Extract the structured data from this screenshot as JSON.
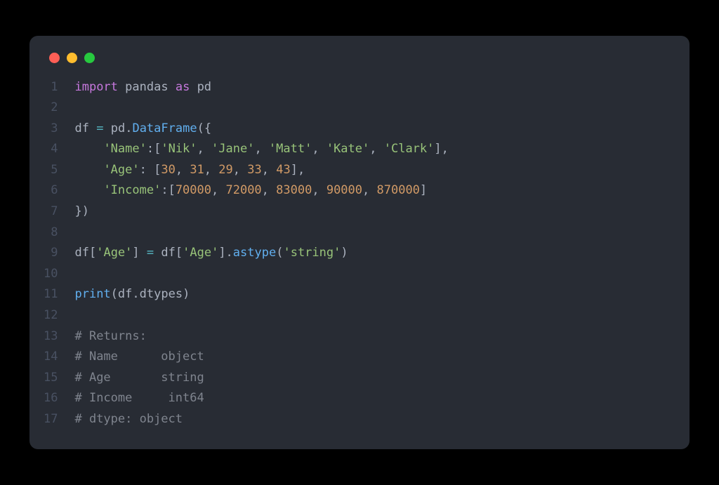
{
  "window": {
    "dots": [
      "close",
      "minimize",
      "zoom"
    ]
  },
  "code": {
    "line_count": 17,
    "tokens": {
      "l1_import": "import",
      "l1_pandas": "pandas",
      "l1_as": "as",
      "l1_pd": "pd",
      "l3_df": "df",
      "l3_eq": "=",
      "l3_pd": "pd",
      "l3_dot": ".",
      "l3_DataFrame": "DataFrame",
      "l3_open": "({",
      "l4_key": "'Name'",
      "l4_colon": ":",
      "l4_v1": "'Nik'",
      "l4_v2": "'Jane'",
      "l4_v3": "'Matt'",
      "l4_v4": "'Kate'",
      "l4_v5": "'Clark'",
      "l5_key": "'Age'",
      "l5_v1": "30",
      "l5_v2": "31",
      "l5_v3": "29",
      "l5_v4": "33",
      "l5_v5": "43",
      "l6_key": "'Income'",
      "l6_v1": "70000",
      "l6_v2": "72000",
      "l6_v3": "83000",
      "l6_v4": "90000",
      "l6_v5": "870000",
      "l7_close": "})",
      "l9_df": "df",
      "l9_idx": "'Age'",
      "l9_eq": "=",
      "l9_df2": "df",
      "l9_idx2": "'Age'",
      "l9_astype": "astype",
      "l9_arg": "'string'",
      "l11_print": "print",
      "l11_df": "df",
      "l11_dtypes": "dtypes",
      "l13": "# Returns:",
      "l14": "# Name      object",
      "l15": "# Age       string",
      "l16": "# Income     int64",
      "l17": "# dtype: object"
    }
  }
}
